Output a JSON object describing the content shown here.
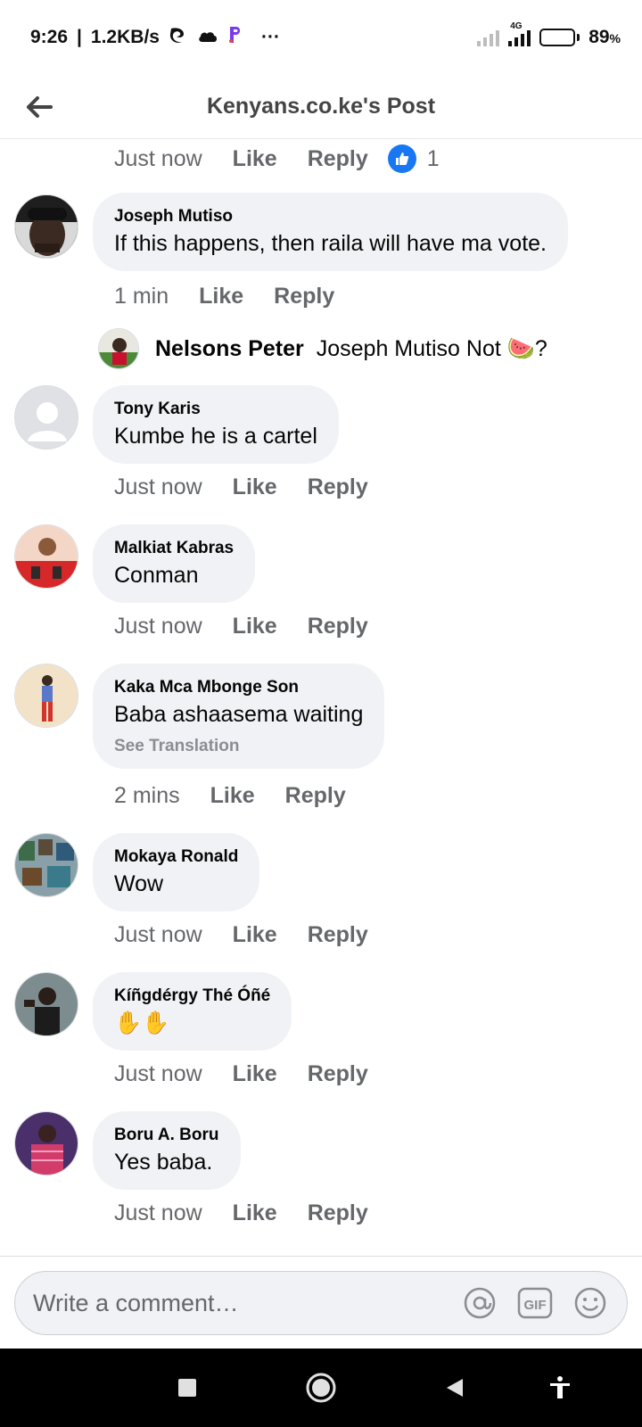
{
  "status_bar": {
    "time": "9:26",
    "speed": "1.2KB/s",
    "network_label": "4G",
    "battery": "89",
    "battery_unit": "%",
    "more": "···"
  },
  "header": {
    "title": "Kenyans.co.ke's Post"
  },
  "top_meta": {
    "time": "Just now",
    "like": "Like",
    "reply": "Reply",
    "likes": "1"
  },
  "comments": [
    {
      "name": "Joseph Mutiso",
      "text": "If this happens, then raila will have ma vote.",
      "time": "1 min",
      "like": "Like",
      "reply": "Reply"
    },
    {
      "name": "Tony Karis",
      "text": "Kumbe he is a cartel",
      "time": "Just now",
      "like": "Like",
      "reply": "Reply"
    },
    {
      "name": "Malkiat Kabras",
      "text": "Conman",
      "time": "Just now",
      "like": "Like",
      "reply": "Reply"
    },
    {
      "name": "Kaka Mca Mbonge Son",
      "text": "Baba ashaasema waiting",
      "see_translation": "See Translation",
      "time": "2 mins",
      "like": "Like",
      "reply": "Reply"
    },
    {
      "name": "Mokaya Ronald",
      "text": "Wow",
      "time": "Just now",
      "like": "Like",
      "reply": "Reply"
    },
    {
      "name": "Kíñgdérgy Thé Óñé",
      "text": "✋✋",
      "time": "Just now",
      "like": "Like",
      "reply": "Reply"
    },
    {
      "name": "Boru A. Boru",
      "text": "Yes baba.",
      "time": "Just now",
      "like": "Like",
      "reply": "Reply"
    }
  ],
  "reply_preview": {
    "name": "Nelsons Peter",
    "text": "Joseph Mutiso Not 🍉?"
  },
  "composer": {
    "placeholder": "Write a comment…"
  },
  "icons": [
    "back-arrow-icon",
    "like-icon",
    "at-icon",
    "gif-icon",
    "smiley-icon",
    "square-icon",
    "circle-icon",
    "triangle-back-icon",
    "accessibility-icon"
  ],
  "colors": {
    "like_blue": "#1877f2",
    "bubble": "#f0f2f5",
    "meta_gray": "#65676b"
  }
}
